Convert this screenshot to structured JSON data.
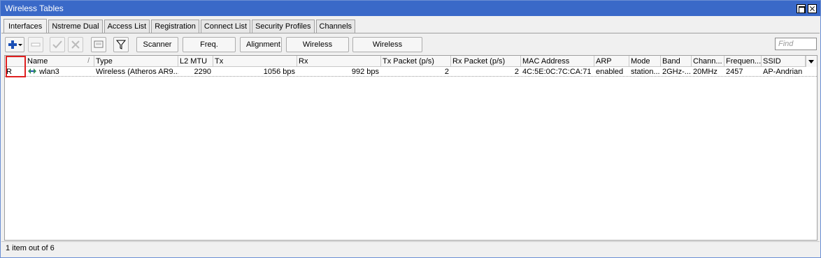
{
  "window": {
    "title": "Wireless Tables"
  },
  "tabs": [
    {
      "label": "Interfaces"
    },
    {
      "label": "Nstreme Dual"
    },
    {
      "label": "Access List"
    },
    {
      "label": "Registration"
    },
    {
      "label": "Connect List"
    },
    {
      "label": "Security Profiles"
    },
    {
      "label": "Channels"
    }
  ],
  "toolbar": {
    "add_icon": "plus-icon",
    "remove_icon": "minus-icon",
    "enable_icon": "check-icon",
    "disable_icon": "x-icon",
    "comment_icon": "comment-icon",
    "filter_icon": "filter-icon",
    "scanner_label": "Scanner",
    "freq_usage_label": "Freq. Usage",
    "alignment_label": "Alignment",
    "wireless_sniffer_label": "Wireless Sniffer",
    "wireless_snooper_label": "Wireless Snooper",
    "find_placeholder": "Find"
  },
  "table": {
    "columns": [
      "",
      "Name",
      "Type",
      "L2 MTU",
      "Tx",
      "Rx",
      "Tx Packet (p/s)",
      "Rx Packet (p/s)",
      "MAC Address",
      "ARP",
      "Mode",
      "Band",
      "Chann...",
      "Frequen...",
      "SSID"
    ],
    "sort_indicator": "/",
    "rows": [
      {
        "flag": "R",
        "name": "wlan3",
        "type": "Wireless (Atheros AR9...",
        "l2mtu": "2290",
        "tx": "1056 bps",
        "rx": "992 bps",
        "tx_packet": "2",
        "rx_packet": "2",
        "mac": "4C:5E:0C:7C:CA:71",
        "arp": "enabled",
        "mode": "station...",
        "band": "2GHz-...",
        "channel": "20MHz",
        "frequency": "2457",
        "ssid": "AP-Andrian"
      }
    ]
  },
  "status": {
    "text": "1 item out of 6"
  },
  "colors": {
    "titlebar": "#3a69c8",
    "highlight": "#e02020",
    "add_icon": "#1a4fb5"
  }
}
